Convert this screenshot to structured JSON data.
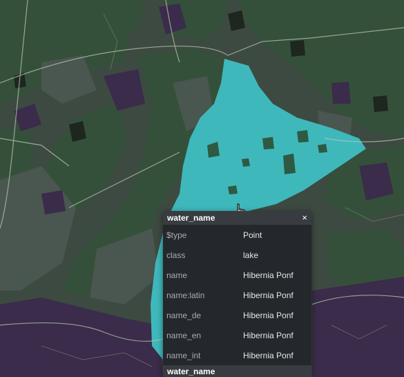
{
  "map": {
    "colors": {
      "forest": "#35503a",
      "urban": "#3f4a44",
      "residential": "#3a2c4a",
      "water": "#3fb8bc",
      "road": "#b8c8b0",
      "dark": "#1e2620"
    }
  },
  "popup": {
    "title": "water_name",
    "close_label": "×",
    "rows": [
      {
        "key": "$type",
        "value": "Point"
      },
      {
        "key": "class",
        "value": "lake"
      },
      {
        "key": "name",
        "value": "Hibernia Ponf"
      },
      {
        "key": "name:latin",
        "value": "Hibernia Ponf"
      },
      {
        "key": "name_de",
        "value": "Hibernia Ponf"
      },
      {
        "key": "name_en",
        "value": "Hibernia Ponf"
      },
      {
        "key": "name_int",
        "value": "Hibernia Ponf"
      }
    ],
    "next_layer_title": "water_name"
  },
  "cursor": {
    "icon": "hand-pointer-icon"
  }
}
